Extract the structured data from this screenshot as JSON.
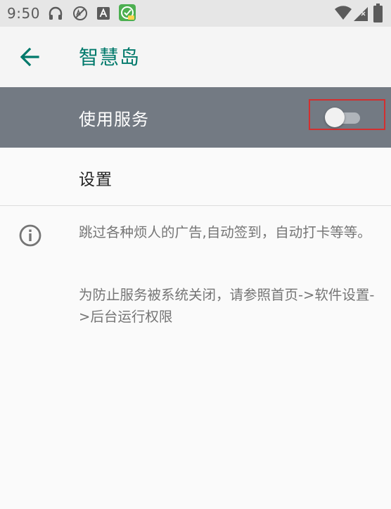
{
  "status_bar": {
    "time": "9:50",
    "left_icons": [
      "headset-icon",
      "ad-block-icon",
      "a-notification-icon",
      "app-notification-icon"
    ],
    "right_icons": [
      "wifi-icon",
      "signal-icon",
      "battery-icon"
    ]
  },
  "app_bar": {
    "title": "智慧岛",
    "back_icon": "arrow-back-icon"
  },
  "master_switch": {
    "label": "使用服务",
    "enabled": false
  },
  "settings": {
    "label": "设置"
  },
  "info": {
    "icon": "info-icon",
    "paragraphs": [
      "跳过各种烦人的广告,自动签到，自动打卡等等。",
      "为防止服务被系统关闭，请参照首页->软件设置->后台运行权限"
    ]
  },
  "colors": {
    "accent": "#00796b",
    "master_bar": "#737a83",
    "highlight_box": "#d32f2f"
  }
}
